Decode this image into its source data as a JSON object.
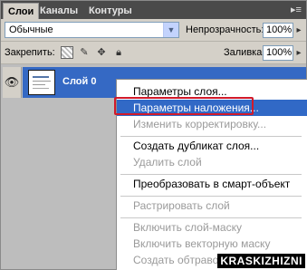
{
  "tabs": [
    {
      "label": "Слои"
    },
    {
      "label": "Каналы"
    },
    {
      "label": "Контуры"
    }
  ],
  "panel_menu_icon": "panel-options-icon",
  "blend_mode": {
    "value": "Обычные"
  },
  "opacity": {
    "label": "Непрозрачность:",
    "value": "100%"
  },
  "lock": {
    "label": "Закрепить:",
    "icons": [
      "lock-transparent-icon",
      "lock-paint-icon",
      "lock-move-icon",
      "lock-all-icon"
    ]
  },
  "fill": {
    "label": "Заливка:",
    "value": "100%"
  },
  "layer": {
    "name": "Слой 0",
    "visibility_icon": "eye-icon"
  },
  "context_menu": {
    "items": [
      {
        "label": "Параметры слоя...",
        "enabled": true
      },
      {
        "label": "Параметры наложения...",
        "enabled": true,
        "highlighted": true
      },
      {
        "label": "Изменить корректировку...",
        "enabled": false
      },
      {
        "label": "Создать дубликат слоя...",
        "enabled": true
      },
      {
        "label": "Удалить слой",
        "enabled": false
      },
      {
        "label": "Преобразовать в смарт-объект",
        "enabled": true
      },
      {
        "label": "Растрировать слой",
        "enabled": false
      },
      {
        "label": "Включить слой-маску",
        "enabled": false
      },
      {
        "label": "Включить векторную маску",
        "enabled": false
      },
      {
        "label": "Создать обтравочную маску",
        "enabled": false
      }
    ]
  },
  "colors": {
    "selection": "#3569c4",
    "highlight_box": "#d11a2a"
  },
  "watermark": "KRASKIZHIZNI"
}
